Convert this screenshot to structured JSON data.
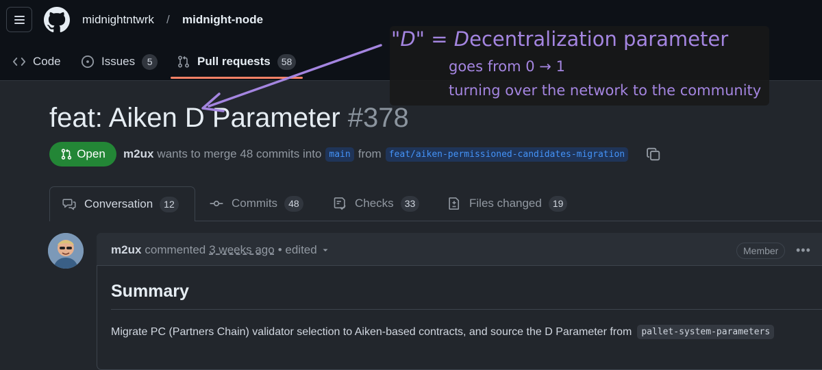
{
  "repo": {
    "owner": "midnightntwrk",
    "separator": "/",
    "name": "midnight-node"
  },
  "nav": {
    "code_label": "Code",
    "issues_label": "Issues",
    "issues_count": "5",
    "pulls_label": "Pull requests",
    "pulls_count": "58"
  },
  "annotation": {
    "line1_quote": "\"D\"",
    "line1_eq": "=",
    "line1_d": "D",
    "line1_rest": "ecentralization parameter",
    "line2": "goes from 0 → 1",
    "line3": "turning over the network to the community",
    "color": "#a485e0"
  },
  "pr": {
    "title": "feat: Aiken D Parameter",
    "number": "#378",
    "status": "Open",
    "author": "m2ux",
    "merge_text": "wants to merge 48 commits into",
    "base_branch": "main",
    "from_text": "from",
    "head_branch": "feat/aiken-permissioned-candidates-migration"
  },
  "tabs": [
    {
      "label": "Conversation",
      "count": "12"
    },
    {
      "label": "Commits",
      "count": "48"
    },
    {
      "label": "Checks",
      "count": "33"
    },
    {
      "label": "Files changed",
      "count": "19"
    }
  ],
  "comment": {
    "author": "m2ux",
    "action": "commented",
    "time": "3 weeks ago",
    "edited": "• edited",
    "role": "Member",
    "more": "•••",
    "heading": "Summary",
    "body": "Migrate PC (Partners Chain) validator selection to Aiken-based contracts, and source the D Parameter from",
    "code": "pallet-system-parameters"
  },
  "colors": {
    "accent_underline": "#f78166",
    "open_green": "#238636",
    "link_blue": "#4493f8"
  }
}
